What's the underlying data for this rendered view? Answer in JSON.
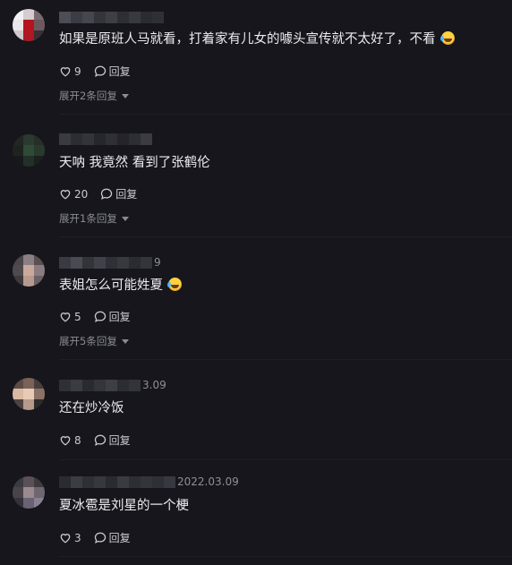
{
  "comments": [
    {
      "date": "",
      "text": "如果是原班人马就看，打着家有儿女的噱头宣传就不太好了，不看",
      "has_emoji": true,
      "likes": "9",
      "reply_label": "回复",
      "expand": "展开2条回复"
    },
    {
      "date": "",
      "text": "天呐 我竟然 看到了张鹤伦",
      "has_emoji": false,
      "likes": "20",
      "reply_label": "回复",
      "expand": "展开1条回复"
    },
    {
      "date": "9",
      "text": "表姐怎么可能姓夏",
      "has_emoji": true,
      "likes": "5",
      "reply_label": "回复",
      "expand": "展开5条回复"
    },
    {
      "date": "3.09",
      "text": "还在炒冷饭",
      "has_emoji": false,
      "likes": "8",
      "reply_label": "回复",
      "expand": ""
    },
    {
      "date": "2022.03.09",
      "text": "夏冰雹是刘星的一个梗",
      "has_emoji": false,
      "likes": "3",
      "reply_label": "回复",
      "expand": ""
    }
  ],
  "icons": {
    "like": "heart-outline-icon",
    "reply": "speech-bubble-icon",
    "expand": "caret-down-icon",
    "emoji": "rolling-laughing-emoji"
  },
  "colors": {
    "background": "#16161c",
    "text": "#ececf0",
    "muted": "#8b8b93"
  }
}
